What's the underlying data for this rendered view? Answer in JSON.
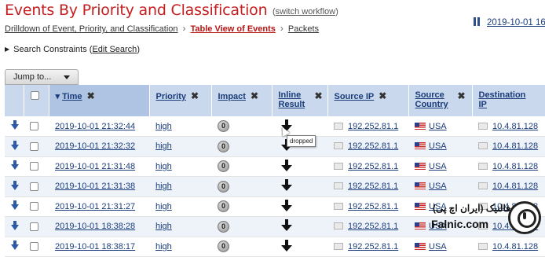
{
  "header": {
    "title": "Events By Priority and Classification",
    "switch_workflow": "switch workflow",
    "date_range": "2019-10-01 16"
  },
  "breadcrumb": {
    "items": [
      "Drilldown of Event, Priority, and Classification",
      "Table View of Events",
      "Packets"
    ]
  },
  "search_constraints": {
    "label": "Search Constraints",
    "edit_link": "Edit Search"
  },
  "jump_to": {
    "label": "Jump to..."
  },
  "table": {
    "columns": [
      "Time",
      "Priority",
      "Impact",
      "Inline Result",
      "Source IP",
      "Source Country",
      "Destination IP"
    ],
    "rows": [
      {
        "time": "2019-10-01 21:32:44",
        "priority": "high",
        "impact": "0",
        "source_ip": "192.252.81.1",
        "source_country": "USA",
        "destination_ip": "10.4.81.128"
      },
      {
        "time": "2019-10-01 21:32:32",
        "priority": "high",
        "impact": "0",
        "source_ip": "192.252.81.1",
        "source_country": "USA",
        "destination_ip": "10.4.81.128"
      },
      {
        "time": "2019-10-01 21:31:48",
        "priority": "high",
        "impact": "0",
        "source_ip": "192.252.81.1",
        "source_country": "USA",
        "destination_ip": "10.4.81.128"
      },
      {
        "time": "2019-10-01 21:31:38",
        "priority": "high",
        "impact": "0",
        "source_ip": "192.252.81.1",
        "source_country": "USA",
        "destination_ip": "10.4.81.128"
      },
      {
        "time": "2019-10-01 21:31:27",
        "priority": "high",
        "impact": "0",
        "source_ip": "192.252.81.1",
        "source_country": "USA",
        "destination_ip": "10.4.81.128"
      },
      {
        "time": "2019-10-01 18:38:28",
        "priority": "high",
        "impact": "0",
        "source_ip": "192.252.81.1",
        "source_country": "USA",
        "destination_ip": "10.4.81.128"
      },
      {
        "time": "2019-10-01 18:38:17",
        "priority": "high",
        "impact": "0",
        "source_ip": "192.252.81.1",
        "source_country": "USA",
        "destination_ip": "10.4.81.128"
      }
    ]
  },
  "tooltip": {
    "text": "dropped"
  },
  "watermark": {
    "fa": "فالنیک (ایران اچ پی)",
    "en": "Falnic.com"
  },
  "icons": {
    "row_arrow": "down-arrow-icon",
    "inline_result": "dropped-arrow-icon",
    "country_flag": "usa-flag-icon",
    "host": "host-icon",
    "pause": "pause-icon"
  },
  "colors": {
    "title": "#c41e1e",
    "header_bg": "#c9d8ec",
    "link": "#1a3c7a",
    "current_breadcrumb": "#b81414"
  }
}
